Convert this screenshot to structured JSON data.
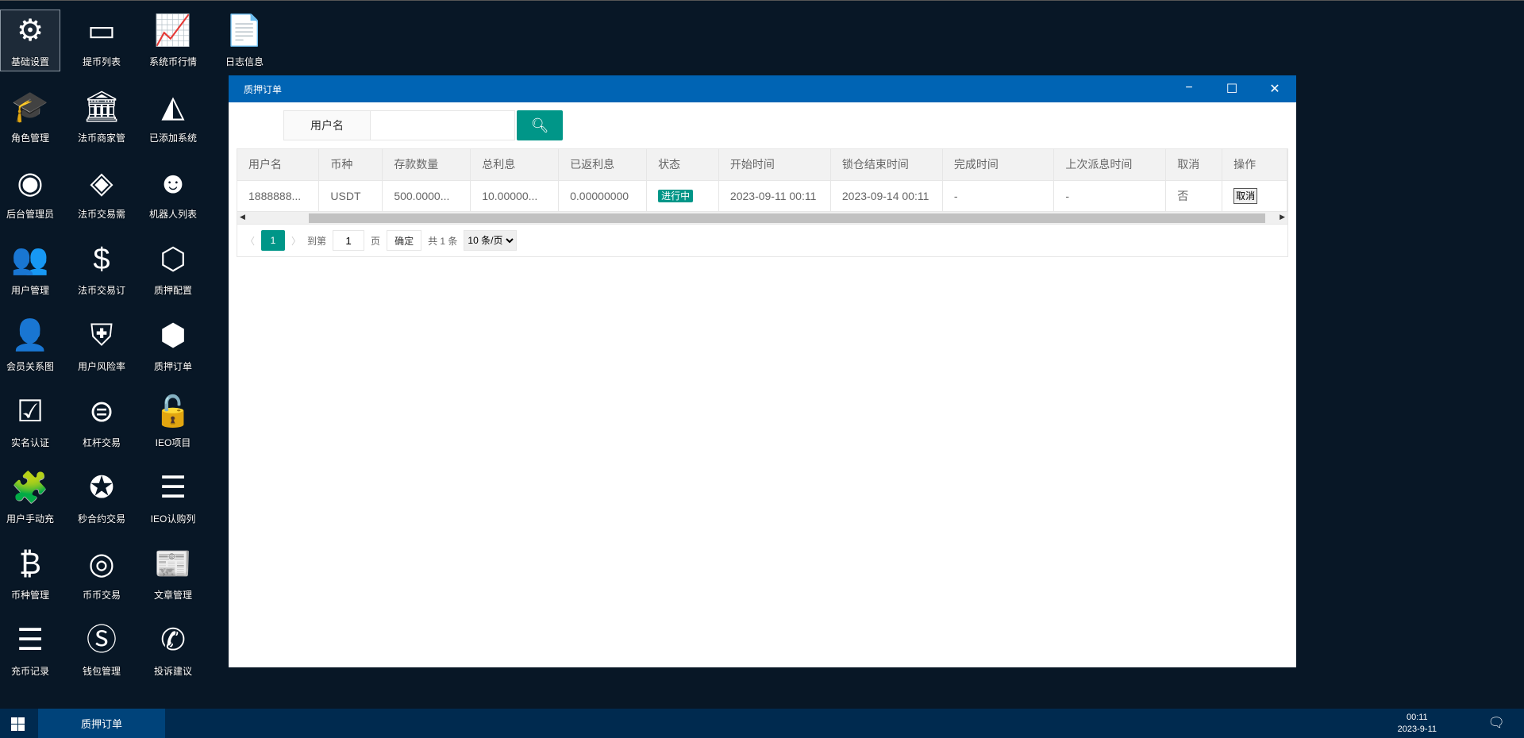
{
  "desktop": {
    "icons": [
      {
        "label": "基础设置",
        "icon": "gears-icon",
        "glyph": "⚙"
      },
      {
        "label": "提币列表",
        "icon": "credit-card-icon",
        "glyph": "▭"
      },
      {
        "label": "系统币行情",
        "icon": "line-chart-icon",
        "glyph": "📈"
      },
      {
        "label": "日志信息",
        "icon": "file-text-icon",
        "glyph": "📄"
      },
      {
        "label": "角色管理",
        "icon": "graduation-cap-icon",
        "glyph": "🎓"
      },
      {
        "label": "法币商家管",
        "icon": "bank-icon",
        "glyph": "🏛"
      },
      {
        "label": "已添加系统",
        "icon": "area-chart-icon",
        "glyph": "◭"
      },
      {
        "label": "后台管理员",
        "icon": "user-circle-icon",
        "glyph": "◉"
      },
      {
        "label": "法币交易需",
        "icon": "exchange-icon",
        "glyph": "◈"
      },
      {
        "label": "机器人列表",
        "icon": "robot-icon",
        "glyph": "☻"
      },
      {
        "label": "用户管理",
        "icon": "users-icon",
        "glyph": "👥"
      },
      {
        "label": "法币交易订",
        "icon": "dollar-icon",
        "glyph": "$"
      },
      {
        "label": "质押配置",
        "icon": "codepen-icon",
        "glyph": "⬡"
      },
      {
        "label": "会员关系图",
        "icon": "user-plus-icon",
        "glyph": "👤"
      },
      {
        "label": "用户风险率",
        "icon": "shield-icon",
        "glyph": "⛨"
      },
      {
        "label": "质押订单",
        "icon": "hexagon-icon",
        "glyph": "⬢"
      },
      {
        "label": "实名认证",
        "icon": "check-square-icon",
        "glyph": "☑"
      },
      {
        "label": "杠杆交易",
        "icon": "globe-icon",
        "glyph": "⊜"
      },
      {
        "label": "IEO项目",
        "icon": "unlock-icon",
        "glyph": "🔓"
      },
      {
        "label": "用户手动充",
        "icon": "puzzle-icon",
        "glyph": "🧩"
      },
      {
        "label": "秒合约交易",
        "icon": "rebel-icon",
        "glyph": "✪"
      },
      {
        "label": "IEO认购列",
        "icon": "list-icon",
        "glyph": "☰"
      },
      {
        "label": "币种管理",
        "icon": "bitcoin-icon",
        "glyph": "₿"
      },
      {
        "label": "币币交易",
        "icon": "mastercard-icon",
        "glyph": "◎"
      },
      {
        "label": "文章管理",
        "icon": "newspaper-icon",
        "glyph": "📰"
      },
      {
        "label": "充币记录",
        "icon": "list-icon",
        "glyph": "☰"
      },
      {
        "label": "钱包管理",
        "icon": "skype-icon",
        "glyph": "Ⓢ"
      },
      {
        "label": "投诉建议",
        "icon": "phone-volume-icon",
        "glyph": "✆"
      }
    ]
  },
  "window": {
    "title": "质押订单",
    "minimize": "−",
    "maximize": "☐",
    "close": "✕",
    "search": {
      "label": "用户名",
      "value": "",
      "placeholder": ""
    },
    "table": {
      "headers": [
        "用户名",
        "币种",
        "存款数量",
        "总利息",
        "已返利息",
        "状态",
        "开始时间",
        "锁仓结束时间",
        "完成时间",
        "上次派息时间",
        "取消",
        "操作"
      ],
      "rows": [
        {
          "user": "1888888...",
          "coin": "USDT",
          "amount": "500.0000...",
          "interest": "10.00000...",
          "returned": "0.00000000",
          "status": "进行中",
          "start": "2023-09-11 00:11",
          "end": "2023-09-14 00:11",
          "finish": "-",
          "last": "-",
          "cancelled": "否",
          "action": "取消"
        }
      ]
    },
    "pager": {
      "prev": "〈",
      "page": "1",
      "next": "〉",
      "goto": "到第",
      "input": "1",
      "unit": "页",
      "confirm": "确定",
      "total": "共 1 条",
      "size": "10 条/页"
    }
  },
  "taskbar": {
    "task": "质押订单",
    "time": "00:11",
    "date": "2023-9-11"
  },
  "colors": {
    "accent": "#009688",
    "titlebar": "#0064b4",
    "desktop": "#081726",
    "taskbar": "#002a4f"
  }
}
